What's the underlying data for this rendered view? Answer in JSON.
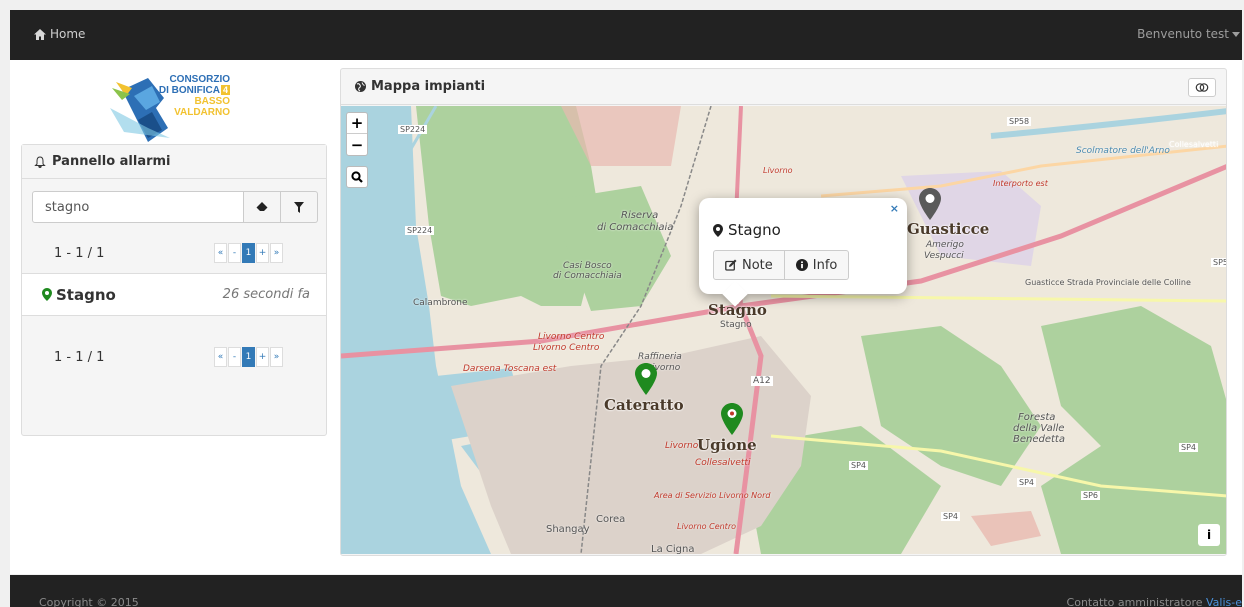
{
  "navbar": {
    "home_label": "Home",
    "welcome_label": "Benvenuto test"
  },
  "logo": {
    "line1": "CONSORZIO",
    "line2": "DI BONIFICA",
    "badge": "4",
    "line3": "BASSO",
    "line4": "VALDARNO"
  },
  "alarm_panel": {
    "title": "Pannello allarmi",
    "search": {
      "value": "stagno",
      "placeholder": ""
    },
    "pagination_top": {
      "range": "1 - 1 / 1",
      "buttons": [
        "«",
        "-",
        "1",
        "+",
        "»"
      ]
    },
    "items": [
      {
        "name": "Stagno",
        "time": "26 secondi fa"
      }
    ],
    "pagination_bottom": {
      "range": "1 - 1 / 1",
      "buttons": [
        "«",
        "-",
        "1",
        "+",
        "»"
      ]
    }
  },
  "map_panel": {
    "title": "Mappa impianti",
    "controls": {
      "zoom_in": "+",
      "zoom_out": "−",
      "info": "i"
    },
    "popup": {
      "title": "Stagno",
      "close": "×",
      "note_label": "Note",
      "info_label": "Info"
    },
    "plant_labels": [
      "Stagno",
      "Cateratto",
      "Ugione",
      "Guasticce"
    ],
    "place_labels": {
      "stagno_small": "Stagno",
      "riserva": "Riserva",
      "comacchiaia": "di Comacchiaia",
      "casi_bosco": "Casi Bosco",
      "casi_bosco2": "di Comacchiaia",
      "calambrone": "Calambrone",
      "livorno_centro": "Livorno Centro",
      "livorno_centro2": "Livorno Centro",
      "darsena": "Darsena Toscana est",
      "raffineria": "Raffineria",
      "raffineria2": "Livorno",
      "livorno": "Livorno",
      "collesalvetti": "Collesalvetti",
      "corea": "Corea",
      "shangay": "Shangay",
      "la_cigna": "La Cigna",
      "foresta": "Foresta",
      "foresta2": "della Valle",
      "foresta3": "Benedetta",
      "guasticce_road": "Guasticce Strada Provinciale delle Colline",
      "area_servizio": "Area di Servizio Livorno Nord",
      "livorno_centro3": "Livorno Centro",
      "interporto": "Interporto est",
      "amerigo": "Amerigo",
      "vespucci": "Vespucci",
      "scolmatore": "Scolmatore dell'Arno",
      "collesalvetti2": "Collesalvetti",
      "a12": "A12",
      "sp224a": "SP224",
      "sp224b": "SP224",
      "sp58": "SP58",
      "sp4a": "SP4",
      "sp4b": "SP4",
      "sp4c": "SP4",
      "sp4d": "SP4",
      "sp6": "SP6",
      "sp5": "SP5",
      "livorno_top": "Livorno"
    }
  },
  "footer": {
    "copyright": "Copyright © 2015",
    "contact_prefix": "Contatto amministratore",
    "contact_link": "Valis-e"
  },
  "colors": {
    "navbar_bg": "#222222",
    "primary": "#337ab7",
    "marker_green": "#1f8a1f",
    "marker_gray": "#5a5a5a",
    "map_land": "#eee8dc",
    "map_sea": "#aad3df",
    "map_forest": "#add19e"
  }
}
